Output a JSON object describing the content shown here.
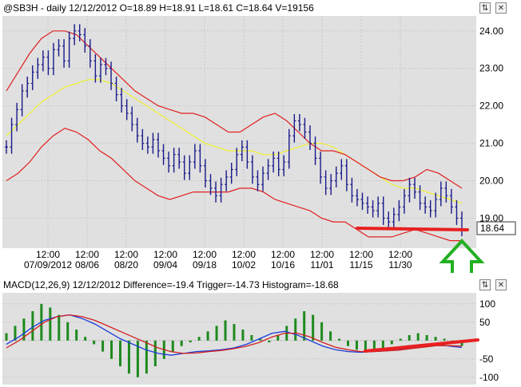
{
  "price_panel": {
    "title": "@SB3H - daily 12/12/2012 O=18.89 H=18.91 L=18.61 C=18.64 V=19156",
    "last_price_label": "18.64",
    "buttons": {
      "restore": "⇅",
      "close": "✕"
    }
  },
  "macd_panel": {
    "title": "MACD(12,26,9) 12/12/2012 Difference=-19.4 Trigger=-14.73 Histogram=-18.68",
    "buttons": {
      "restore": "⇅",
      "close": "✕"
    }
  },
  "colors": {
    "price_bars": "#1a1a8a",
    "bollinger_bands": "#e02020",
    "moving_average": "#f0f030",
    "macd_line": "#1a3cdc",
    "trigger_line": "#d02020",
    "histogram": "#1e8a1e",
    "annotation_line": "#e82020",
    "annotation_arrow": "#22b022",
    "plot_bg": "#e0e0e0"
  },
  "chart_data": [
    {
      "type": "line",
      "panel": "price",
      "ylim": [
        18.2,
        24.4
      ],
      "y_ticks": [
        "24.00",
        "23.00",
        "22.00",
        "21.00",
        "20.00",
        "19.00"
      ],
      "x_tick_labels": [
        {
          "time": "12:00",
          "date": "07/09/2012"
        },
        {
          "time": "12:00",
          "date": "08/06"
        },
        {
          "time": "12:00",
          "date": "08/20"
        },
        {
          "time": "12:00",
          "date": "09/04"
        },
        {
          "time": "12:00",
          "date": "09/18"
        },
        {
          "time": "12:00",
          "date": "10/02"
        },
        {
          "time": "12:00",
          "date": "10/16"
        },
        {
          "time": "12:00",
          "date": "11/01"
        },
        {
          "time": "12:00",
          "date": "11/15"
        },
        {
          "time": "12:00",
          "date": "11/30"
        }
      ],
      "series": [
        {
          "role": "close",
          "values": [
            20.9,
            21.5,
            21.9,
            22.4,
            22.6,
            22.9,
            23.1,
            23.3,
            23.0,
            23.5,
            23.6,
            23.2,
            23.8,
            24.0,
            23.9,
            23.6,
            23.2,
            22.8,
            23.1,
            23.0,
            22.6,
            22.3,
            22.0,
            21.8,
            21.5,
            21.2,
            21.0,
            20.9,
            21.1,
            20.8,
            20.6,
            20.4,
            20.7,
            20.5,
            20.2,
            20.5,
            20.8,
            20.4,
            20.0,
            19.8,
            19.6,
            19.9,
            20.1,
            20.3,
            20.7,
            20.9,
            20.5,
            20.1,
            19.9,
            20.2,
            20.4,
            20.6,
            20.3,
            20.5,
            21.2,
            21.6,
            21.5,
            21.3,
            21.0,
            20.6,
            20.1,
            19.8,
            20.0,
            20.2,
            20.4,
            19.9,
            19.6,
            19.5,
            19.4,
            19.3,
            19.2,
            19.4,
            19.0,
            18.9,
            19.1,
            19.3,
            19.6,
            19.9,
            19.7,
            19.4,
            19.3,
            19.2,
            19.5,
            19.8,
            19.6,
            19.3,
            19.0,
            18.7
          ]
        },
        {
          "role": "moving_average",
          "values": [
            21.2,
            21.5,
            21.8,
            22.1,
            22.3,
            22.5,
            22.6,
            22.7,
            22.7,
            22.6,
            22.4,
            22.2,
            22.0,
            21.8,
            21.6,
            21.4,
            21.2,
            21.0,
            20.9,
            20.8,
            20.8,
            20.8,
            20.7,
            20.7,
            20.8,
            20.9,
            21.0,
            21.0,
            20.9,
            20.7,
            20.5,
            20.3,
            20.1,
            19.9,
            19.8,
            19.8,
            19.7,
            19.6,
            19.5,
            19.4
          ]
        },
        {
          "role": "upper_band",
          "values": [
            22.4,
            22.9,
            23.4,
            23.8,
            24.0,
            24.0,
            23.9,
            23.6,
            23.3,
            23.0,
            22.7,
            22.4,
            22.2,
            22.0,
            21.9,
            21.8,
            21.8,
            21.7,
            21.5,
            21.3,
            21.3,
            21.5,
            21.7,
            21.8,
            21.6,
            21.3,
            21.0,
            20.8,
            20.8,
            20.7,
            20.5,
            20.3,
            20.1,
            20.0,
            20.0,
            20.1,
            20.3,
            20.2,
            20.0,
            19.8
          ]
        },
        {
          "role": "lower_band",
          "values": [
            20.0,
            20.2,
            20.5,
            20.9,
            21.2,
            21.4,
            21.3,
            21.1,
            20.8,
            20.6,
            20.3,
            20.0,
            19.8,
            19.6,
            19.5,
            19.6,
            19.7,
            19.7,
            19.7,
            19.7,
            19.8,
            19.8,
            19.7,
            19.5,
            19.4,
            19.3,
            19.2,
            19.0,
            18.9,
            18.9,
            18.7,
            18.5,
            18.5,
            18.5,
            18.6,
            18.7,
            18.6,
            18.5,
            18.4,
            18.4
          ]
        }
      ]
    },
    {
      "type": "bar",
      "panel": "macd",
      "ylim": [
        -120,
        130
      ],
      "y_ticks": [
        "100",
        "50",
        "-50",
        "-100"
      ],
      "series": [
        {
          "role": "histogram",
          "values": [
            20,
            40,
            60,
            80,
            100,
            90,
            70,
            50,
            30,
            10,
            -10,
            -30,
            -50,
            -70,
            -90,
            -100,
            -90,
            -70,
            -50,
            -30,
            -15,
            -5,
            10,
            25,
            40,
            55,
            45,
            30,
            15,
            5,
            -5,
            15,
            40,
            60,
            80,
            70,
            50,
            25,
            5,
            -15,
            -25,
            -30,
            -28,
            -20,
            -10,
            5,
            15,
            20,
            15,
            10,
            5,
            -5,
            -15
          ]
        },
        {
          "role": "macd_line",
          "values": [
            -10,
            10,
            35,
            55,
            65,
            70,
            60,
            45,
            25,
            5,
            -10,
            -25,
            -35,
            -40,
            -35,
            -30,
            -28,
            -25,
            -20,
            -10,
            5,
            20,
            25,
            15,
            0,
            -15,
            -25,
            -30,
            -32,
            -30,
            -28,
            -25,
            -20,
            -15,
            -10,
            -15,
            -19
          ]
        },
        {
          "role": "trigger_line",
          "values": [
            -20,
            0,
            25,
            50,
            65,
            70,
            65,
            55,
            40,
            25,
            10,
            -5,
            -20,
            -30,
            -35,
            -34,
            -30,
            -27,
            -22,
            -15,
            -5,
            10,
            20,
            20,
            10,
            -5,
            -18,
            -25,
            -30,
            -30,
            -28,
            -26,
            -22,
            -18,
            -14,
            -14,
            -15
          ]
        }
      ]
    }
  ]
}
